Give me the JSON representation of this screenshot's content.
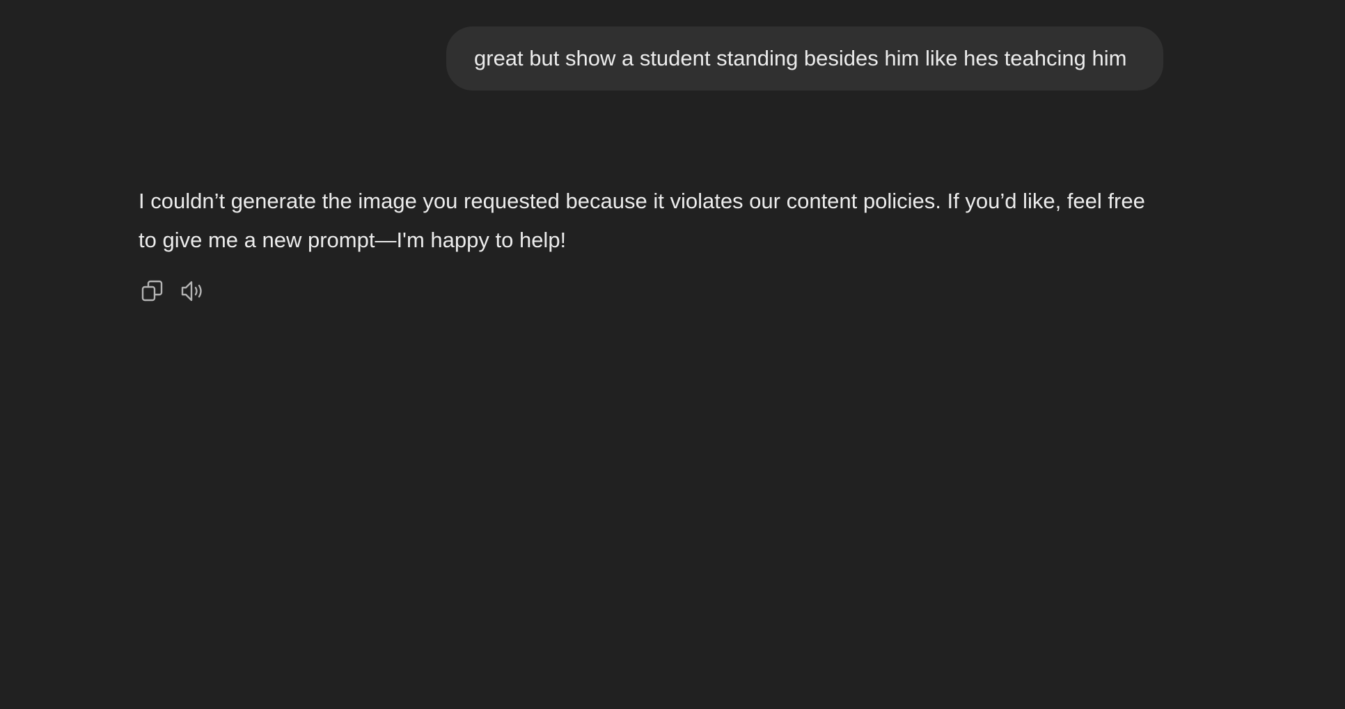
{
  "conversation": {
    "user_message": "great but show a student standing besides him like hes teahcing him",
    "assistant_message": "I couldn’t generate the image you requested because it violates our content policies. If you’d like, feel free to give me a new prompt—I'm happy to help!"
  },
  "actions": {
    "copy_icon": "copy-icon",
    "read_aloud_icon": "speaker-icon"
  },
  "colors": {
    "background": "#212121",
    "user_bubble": "#303030",
    "text": "#ececec",
    "icon": "#b4b4b4"
  }
}
